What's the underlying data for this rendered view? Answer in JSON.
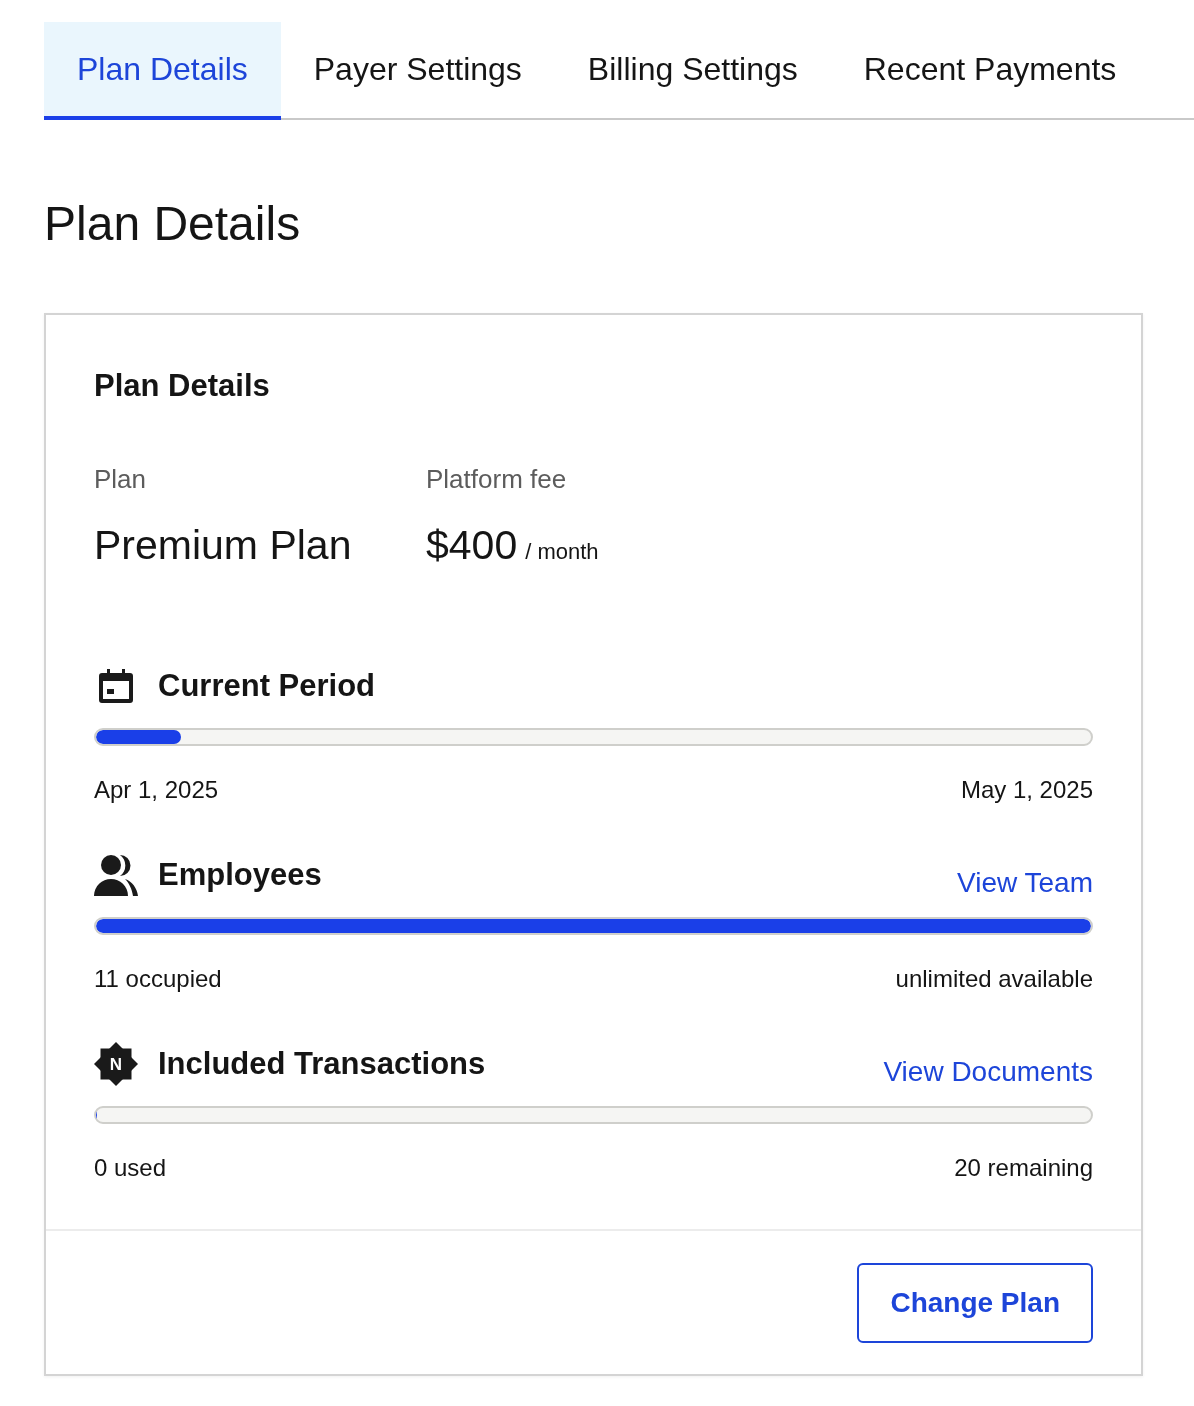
{
  "tabs": [
    {
      "label": "Plan Details",
      "selected": true
    },
    {
      "label": "Payer Settings",
      "selected": false
    },
    {
      "label": "Billing Settings",
      "selected": false
    },
    {
      "label": "Recent Payments",
      "selected": false
    }
  ],
  "page_title": "Plan Details",
  "card": {
    "title": "Plan Details",
    "fields": [
      {
        "label": "Plan",
        "value": "Premium Plan"
      },
      {
        "label": "Platform fee",
        "value": "$400",
        "unit": "/ month"
      }
    ],
    "meters": [
      {
        "kind": "calendar",
        "title": "Current Period",
        "level": 0.085,
        "start": "Apr 1, 2025",
        "end": "May 1, 2025"
      },
      {
        "kind": "people",
        "title": "Employees",
        "link": "View Team",
        "level": 1,
        "start": "11 occupied",
        "end": "unlimited available"
      },
      {
        "kind": "badge",
        "title": "Included Transactions",
        "link": "View Documents",
        "icon_text": "N",
        "level": 0,
        "start": "0 used",
        "end": "20 remaining"
      }
    ],
    "button": "Change Plan"
  }
}
